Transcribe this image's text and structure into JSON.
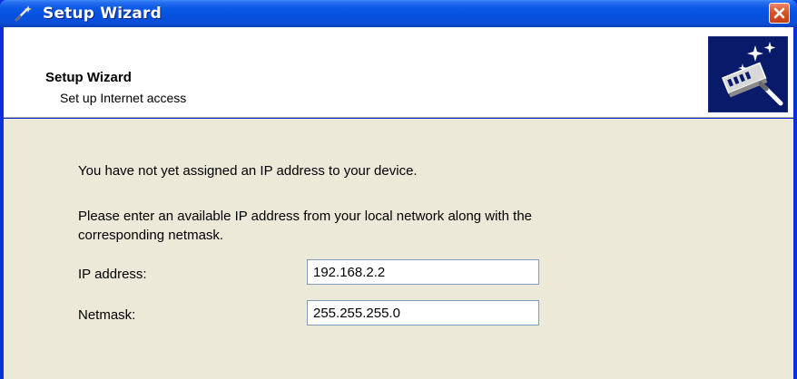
{
  "window": {
    "title": "Setup Wizard"
  },
  "header": {
    "title": "Setup Wizard",
    "subtitle": "Set up Internet access"
  },
  "body": {
    "notice": "You have not yet assigned an IP address to your device.",
    "instruction_line1": "Please enter an available IP address from your local network along with the",
    "instruction_line2": "corresponding netmask.",
    "ip_label": "IP address:",
    "ip_value": "192.168.2.2",
    "netmask_label": "Netmask:",
    "netmask_value": "255.255.255.0"
  },
  "icons": {
    "title": "wand-icon",
    "close": "close-icon",
    "header": "wizard-device-icon"
  },
  "colors": {
    "titlebar": "#0a58e4",
    "frame": "#0831d9",
    "dialog_bg": "#ece9d8",
    "close": "#d8542a"
  }
}
